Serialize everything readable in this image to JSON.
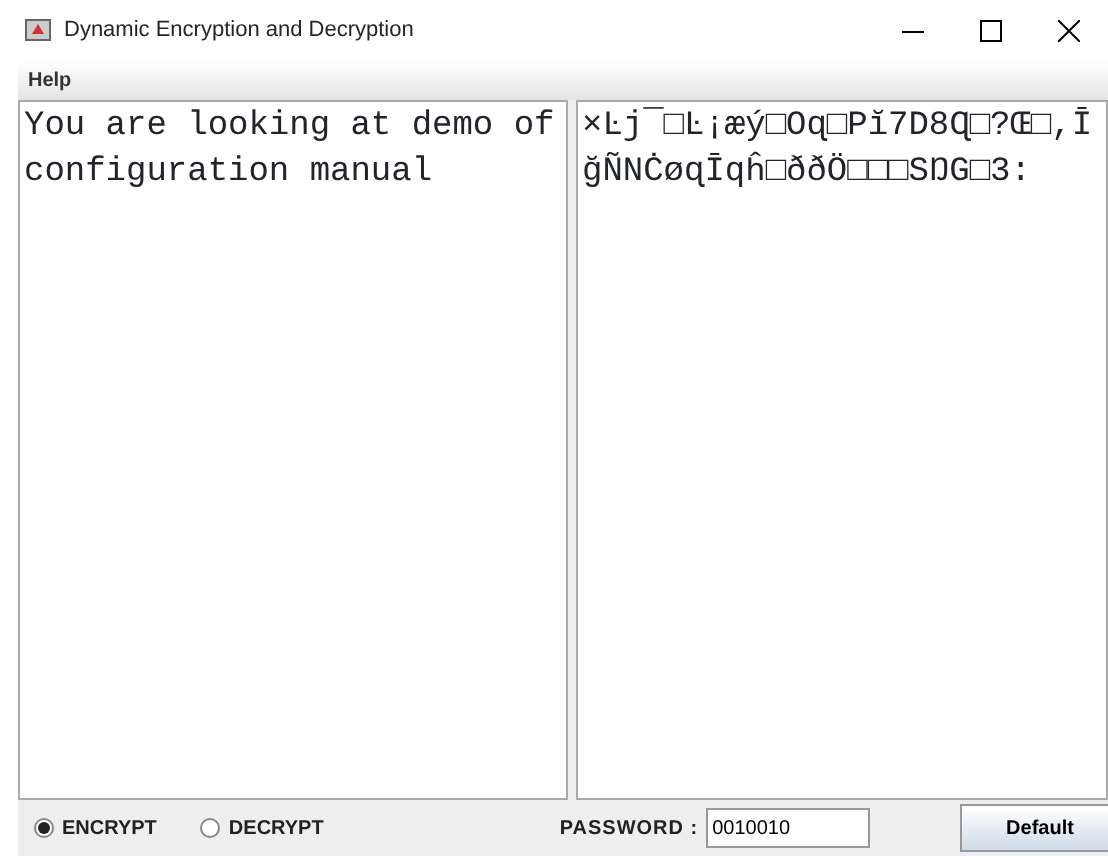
{
  "window": {
    "title": "Dynamic Encryption and Decryption"
  },
  "menu": [
    "Help"
  ],
  "input_text": [
    "You are looking at demo of",
    "configuration manual"
  ],
  "output_text": [
    "×Ŀj¯□Ŀ¡æý□Oɋ□Pĭ7D8Ɋ□?Œ□,Ī",
    "ğÑNĊøɋĪqĥ□ððÖ□□□SŊG□3:"
  ],
  "modes": [
    {
      "label": "ENCRYPT",
      "selected": true
    },
    {
      "label": "DECRYPT",
      "selected": false
    }
  ],
  "password": {
    "label": "PASSWORD :",
    "value": "0010010"
  },
  "buttons": [
    "Default"
  ]
}
